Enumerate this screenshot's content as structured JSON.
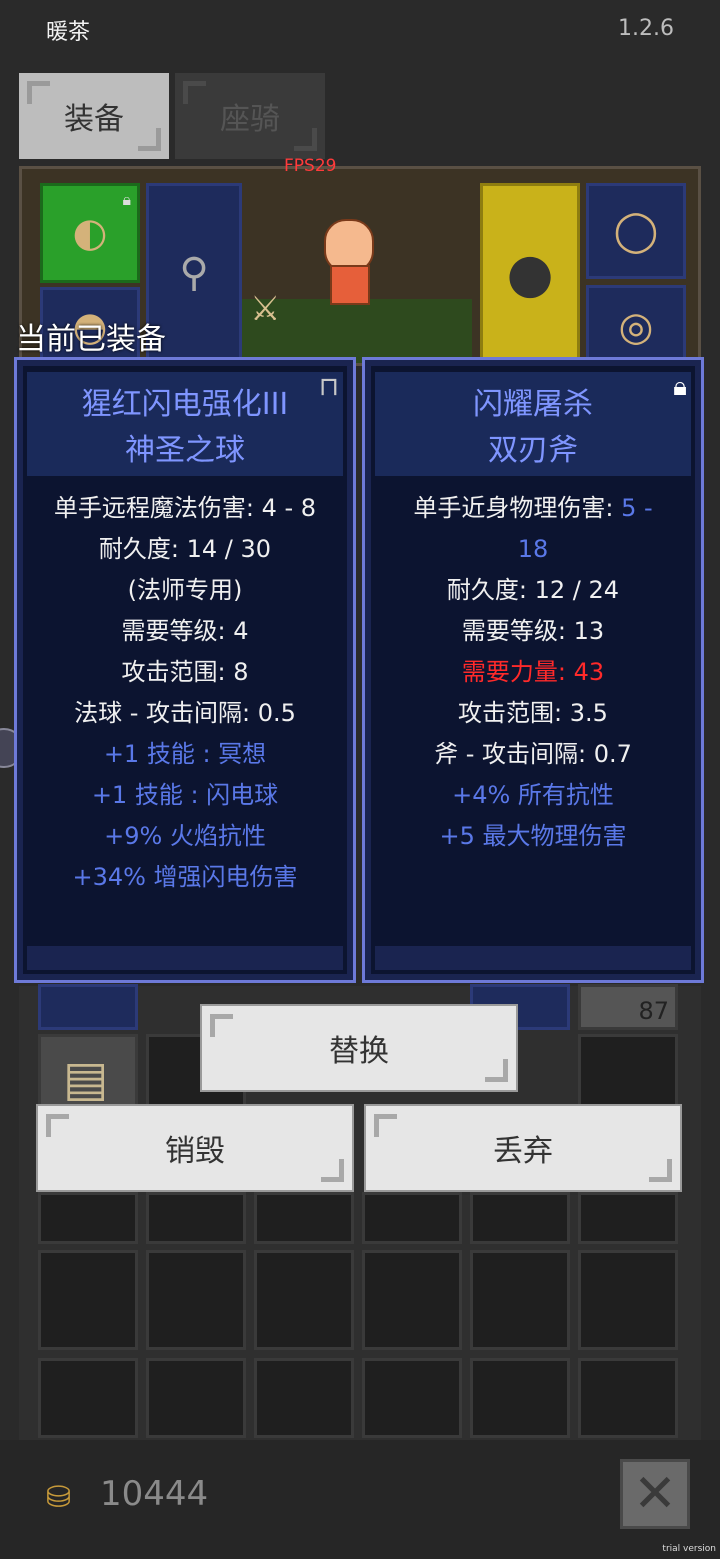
{
  "status": {
    "app_name": "暖茶",
    "version": "1.2.6"
  },
  "tabs": [
    {
      "label": "装备",
      "active": true
    },
    {
      "label": "座骑",
      "active": false
    }
  ],
  "fps": "FPS29",
  "equipped_label": "当前已装备",
  "left_item": {
    "name_line1": "猩红闪电强化III",
    "name_line2": "神圣之球",
    "lock_icon": "unlocked-padlock-icon",
    "stats": [
      {
        "text": "单手远程魔法伤害: 4 - 8",
        "color": "white"
      },
      {
        "text": "耐久度: 14 / 30",
        "color": "white"
      },
      {
        "text": "(法师专用)",
        "color": "white"
      },
      {
        "text": "需要等级: 4",
        "color": "white"
      },
      {
        "text": "攻击范围: 8",
        "color": "white"
      },
      {
        "text": "法球 - 攻击间隔: 0.5",
        "color": "white"
      },
      {
        "text": "+1 技能 : 冥想",
        "color": "blue"
      },
      {
        "text": "+1 技能 : 闪电球",
        "color": "blue"
      },
      {
        "text": "+9% 火焰抗性",
        "color": "blue"
      },
      {
        "text": "+34% 增强闪电伤害",
        "color": "blue"
      }
    ]
  },
  "right_item": {
    "name_line1": "闪耀屠杀",
    "name_line2": "双刃斧",
    "lock_icon": "locked-padlock-icon",
    "stat_damage_label": "单手近身物理伤害: ",
    "stat_damage_value_a": "5 -",
    "stat_damage_value_b": "18",
    "stats": [
      {
        "text": "耐久度: 12 / 24",
        "color": "white"
      },
      {
        "text": "需要等级: 13",
        "color": "white"
      },
      {
        "text": "需要力量: 43",
        "color": "red"
      },
      {
        "text": "攻击范围: 3.5",
        "color": "white"
      },
      {
        "text": "斧 - 攻击间隔: 0.7",
        "color": "white"
      },
      {
        "text": "+4% 所有抗性",
        "color": "blue"
      },
      {
        "text": "+5 最大物理伤害",
        "color": "blue"
      }
    ]
  },
  "stack_count": "87",
  "buttons": {
    "replace": "替换",
    "destroy": "销毁",
    "discard": "丢弃"
  },
  "coins": "10444",
  "watermark": "trial version",
  "colors": {
    "blue_stat": "#5a78e8",
    "red_stat": "#ff2a2a",
    "title_blue": "#7f95ff"
  }
}
